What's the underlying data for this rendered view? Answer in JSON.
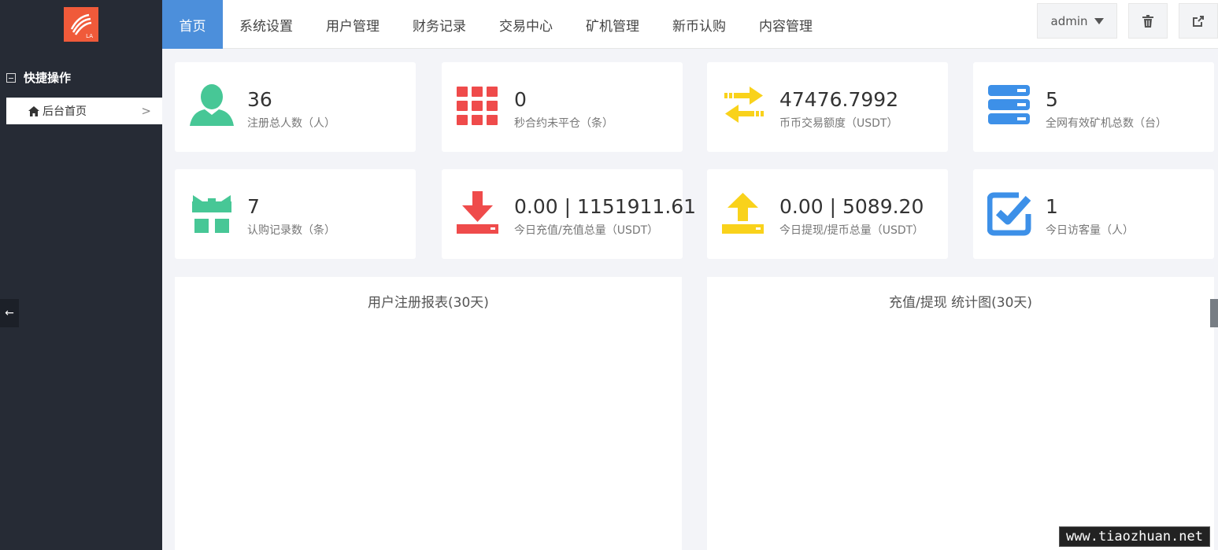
{
  "header": {
    "nav": [
      "首页",
      "系统设置",
      "用户管理",
      "财务记录",
      "交易中心",
      "矿机管理",
      "新币认购",
      "内容管理"
    ],
    "admin_label": "admin",
    "logo_text": "LA"
  },
  "sidebar": {
    "section_title": "快捷操作",
    "item_label": "后台首页",
    "collapse_icon": "←"
  },
  "stats": [
    {
      "value": "36",
      "label": "注册总人数（人）",
      "icon": "user-icon",
      "color": "#47c796"
    },
    {
      "value": "0",
      "label": "秒合约未平仓（条）",
      "icon": "grid-icon",
      "color": "#ef4b4b"
    },
    {
      "value": "47476.7992",
      "label": "币币交易额度（USDT）",
      "icon": "exchange-icon",
      "color": "#f9d21b"
    },
    {
      "value": "5",
      "label": "全网有效矿机总数（台）",
      "icon": "server-icon",
      "color": "#3d90e8"
    },
    {
      "value": "7",
      "label": "认购记录数（条）",
      "icon": "gift-icon",
      "color": "#47c796"
    },
    {
      "value": "0.00 | 1151911.61",
      "label": "今日充值/充值总量（USDT）",
      "icon": "download-icon",
      "color": "#ef4b4b"
    },
    {
      "value": "0.00 | 5089.20",
      "label": "今日提现/提币总量（USDT）",
      "icon": "upload-icon",
      "color": "#f9d21b"
    },
    {
      "value": "1",
      "label": "今日访客量（人）",
      "icon": "checkbox-icon",
      "color": "#3d90e8"
    }
  ],
  "panels": {
    "left_title": "用户注册报表(30天)",
    "right_title": "充值/提现 统计图(30天)"
  },
  "watermark": "www.tiaozhuan.net"
}
